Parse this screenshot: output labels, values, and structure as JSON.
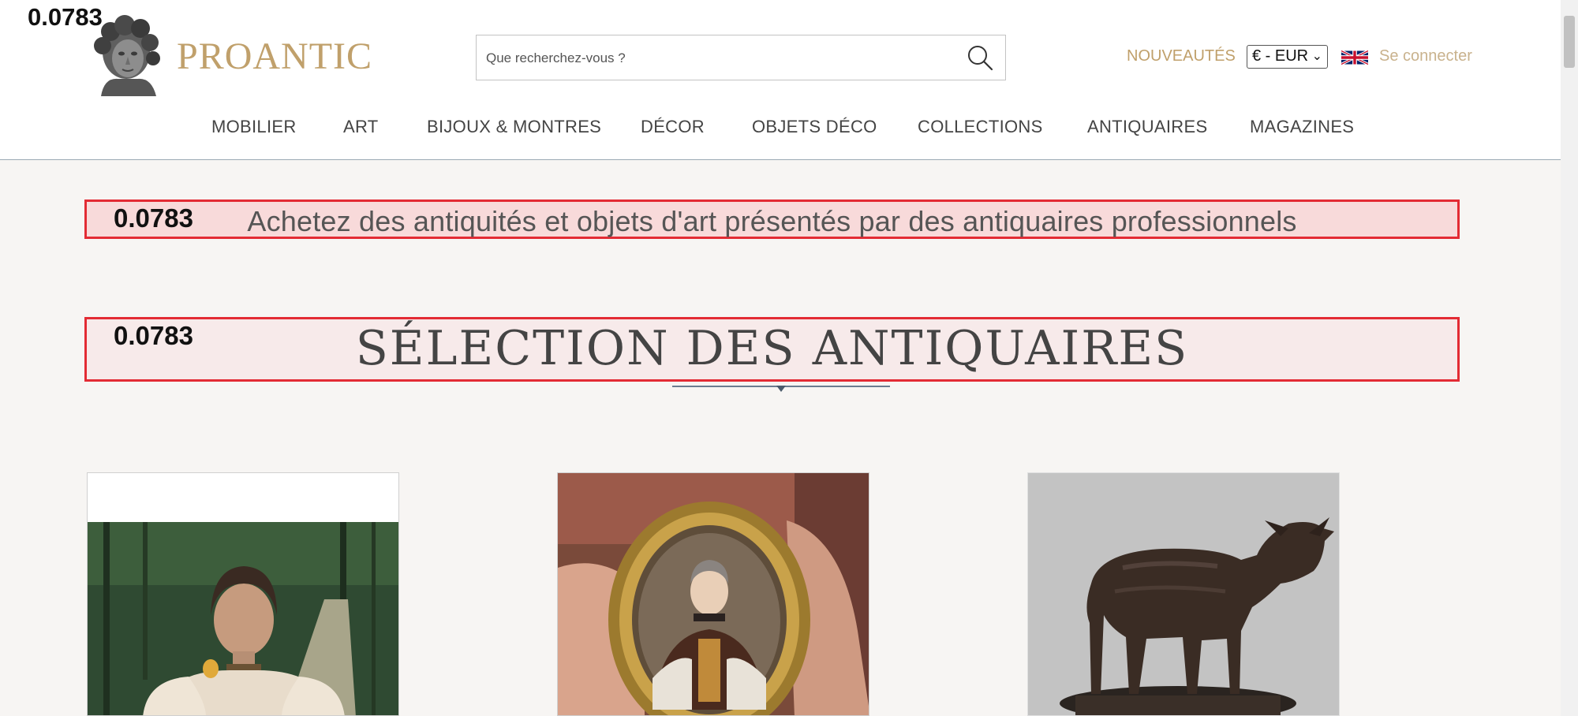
{
  "debug_scores": {
    "top": "0.0783",
    "banner1": "0.0783",
    "banner2": "0.0783"
  },
  "brand": {
    "name": "PROANTIC",
    "color": "#c0a06b"
  },
  "search": {
    "placeholder": "Que recherchez-vous ?",
    "value": ""
  },
  "header_links": {
    "nouveautes": "NOUVEAUTÉS",
    "currency": "€ - EUR",
    "language_flag": "uk-flag-icon",
    "login": "Se connecter"
  },
  "nav": {
    "items": [
      {
        "label": "MOBILIER"
      },
      {
        "label": "ART"
      },
      {
        "label": "BIJOUX & MONTRES"
      },
      {
        "label": "DÉCOR"
      },
      {
        "label": "OBJETS DÉCO"
      },
      {
        "label": "COLLECTIONS"
      },
      {
        "label": "ANTIQUAIRES"
      },
      {
        "label": "MAGAZINES"
      }
    ]
  },
  "main": {
    "tagline": "Achetez des antiquités et objets d'art présentés par des antiquaires professionnels",
    "section_title": "SÉLECTION DES ANTIQUAIRES",
    "highlight_color": "#e32b34",
    "products": [
      {
        "image": "portrait-painting-image"
      },
      {
        "image": "miniature-portrait-image"
      },
      {
        "image": "bronze-lamb-sculpture-image"
      }
    ]
  }
}
